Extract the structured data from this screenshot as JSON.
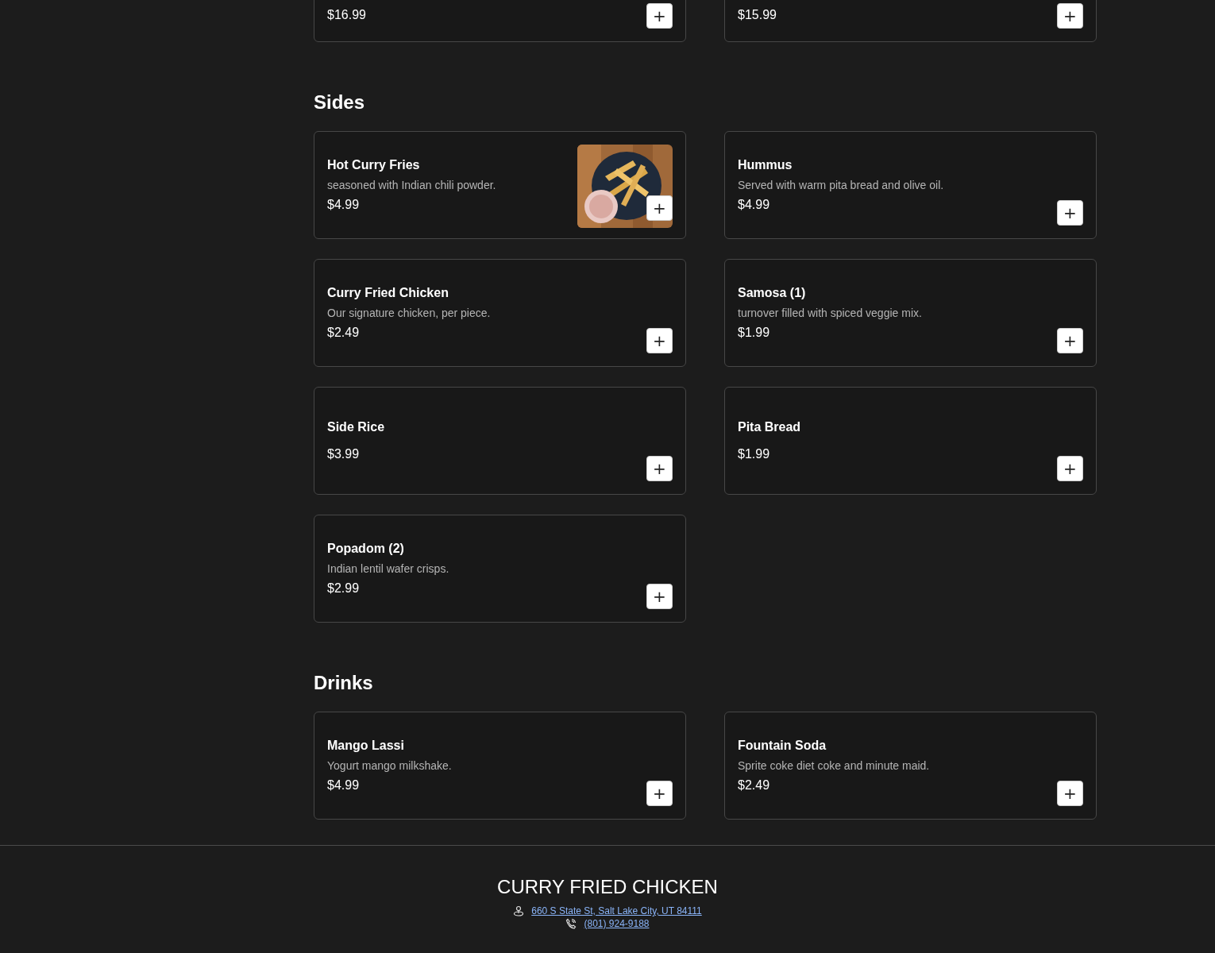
{
  "sections": [
    {
      "items": [
        {
          "kind": "plain",
          "price": "$16.99"
        },
        {
          "kind": "plain",
          "price": "$15.99"
        }
      ]
    },
    {
      "title": "Sides",
      "items": [
        {
          "kind": "picture",
          "name": "Hot Curry Fries",
          "description": "seasoned with Indian chili powder.",
          "price": "$4.99"
        },
        {
          "kind": "plain",
          "name": "Hummus",
          "description": "Served with warm pita bread and olive oil.",
          "price": "$4.99"
        },
        {
          "kind": "plain",
          "name": "Curry Fried Chicken",
          "description": "Our signature chicken, per piece.",
          "price": "$2.49"
        },
        {
          "kind": "plain",
          "name": "Samosa (1)",
          "description": "turnover filled with spiced veggie mix.",
          "price": "$1.99"
        },
        {
          "kind": "plain",
          "name": "Side Rice",
          "price": "$3.99"
        },
        {
          "kind": "plain",
          "name": "Pita Bread",
          "price": "$1.99"
        },
        {
          "kind": "plain",
          "name": "Popadom (2)",
          "description": "Indian lentil wafer crisps.",
          "price": "$2.99"
        }
      ]
    },
    {
      "title": "Drinks",
      "items": [
        {
          "kind": "plain",
          "name": "Mango Lassi",
          "description": "Yogurt mango milkshake.",
          "price": "$4.99"
        },
        {
          "kind": "plain",
          "name": "Fountain Soda",
          "description": "Sprite coke diet coke and minute maid.",
          "price": "$2.49"
        }
      ]
    }
  ],
  "add_button": "+",
  "footer": {
    "title": "CURRY FRIED CHICKEN",
    "address": "660 S State St, Salt Lake City, UT 84111",
    "phone": "(801) 924-9188"
  }
}
